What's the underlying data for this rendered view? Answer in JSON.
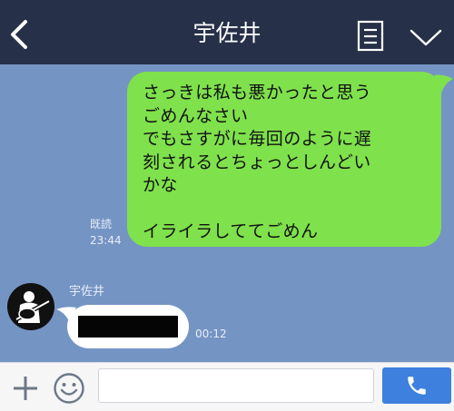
{
  "header": {
    "title": "宇佐井",
    "back_icon": "chevron-left-icon",
    "menu_icon": "notes-menu-icon",
    "more_icon": "chevron-down-icon"
  },
  "messages": [
    {
      "direction": "sent",
      "text": "さっきは私も悪かったと思う\nごめんなさい\nでもさすがに毎回のように遅\n刻されるとちょっとしんどい\nかな\n\nイライラしててごめん",
      "read_label": "既読",
      "time": "23:44"
    },
    {
      "direction": "received",
      "sender": "宇佐井",
      "content": "[redacted]",
      "time": "00:12"
    }
  ],
  "input_bar": {
    "placeholder": "",
    "value": "",
    "plus_icon": "plus-icon",
    "emoji_icon": "emoji-icon",
    "call_icon": "phone-icon"
  },
  "colors": {
    "header_bg": "#263049",
    "chat_bg": "#7494c4",
    "sent_bubble": "#7fe14c",
    "received_bubble": "#ffffff",
    "call_button": "#3d80de"
  }
}
